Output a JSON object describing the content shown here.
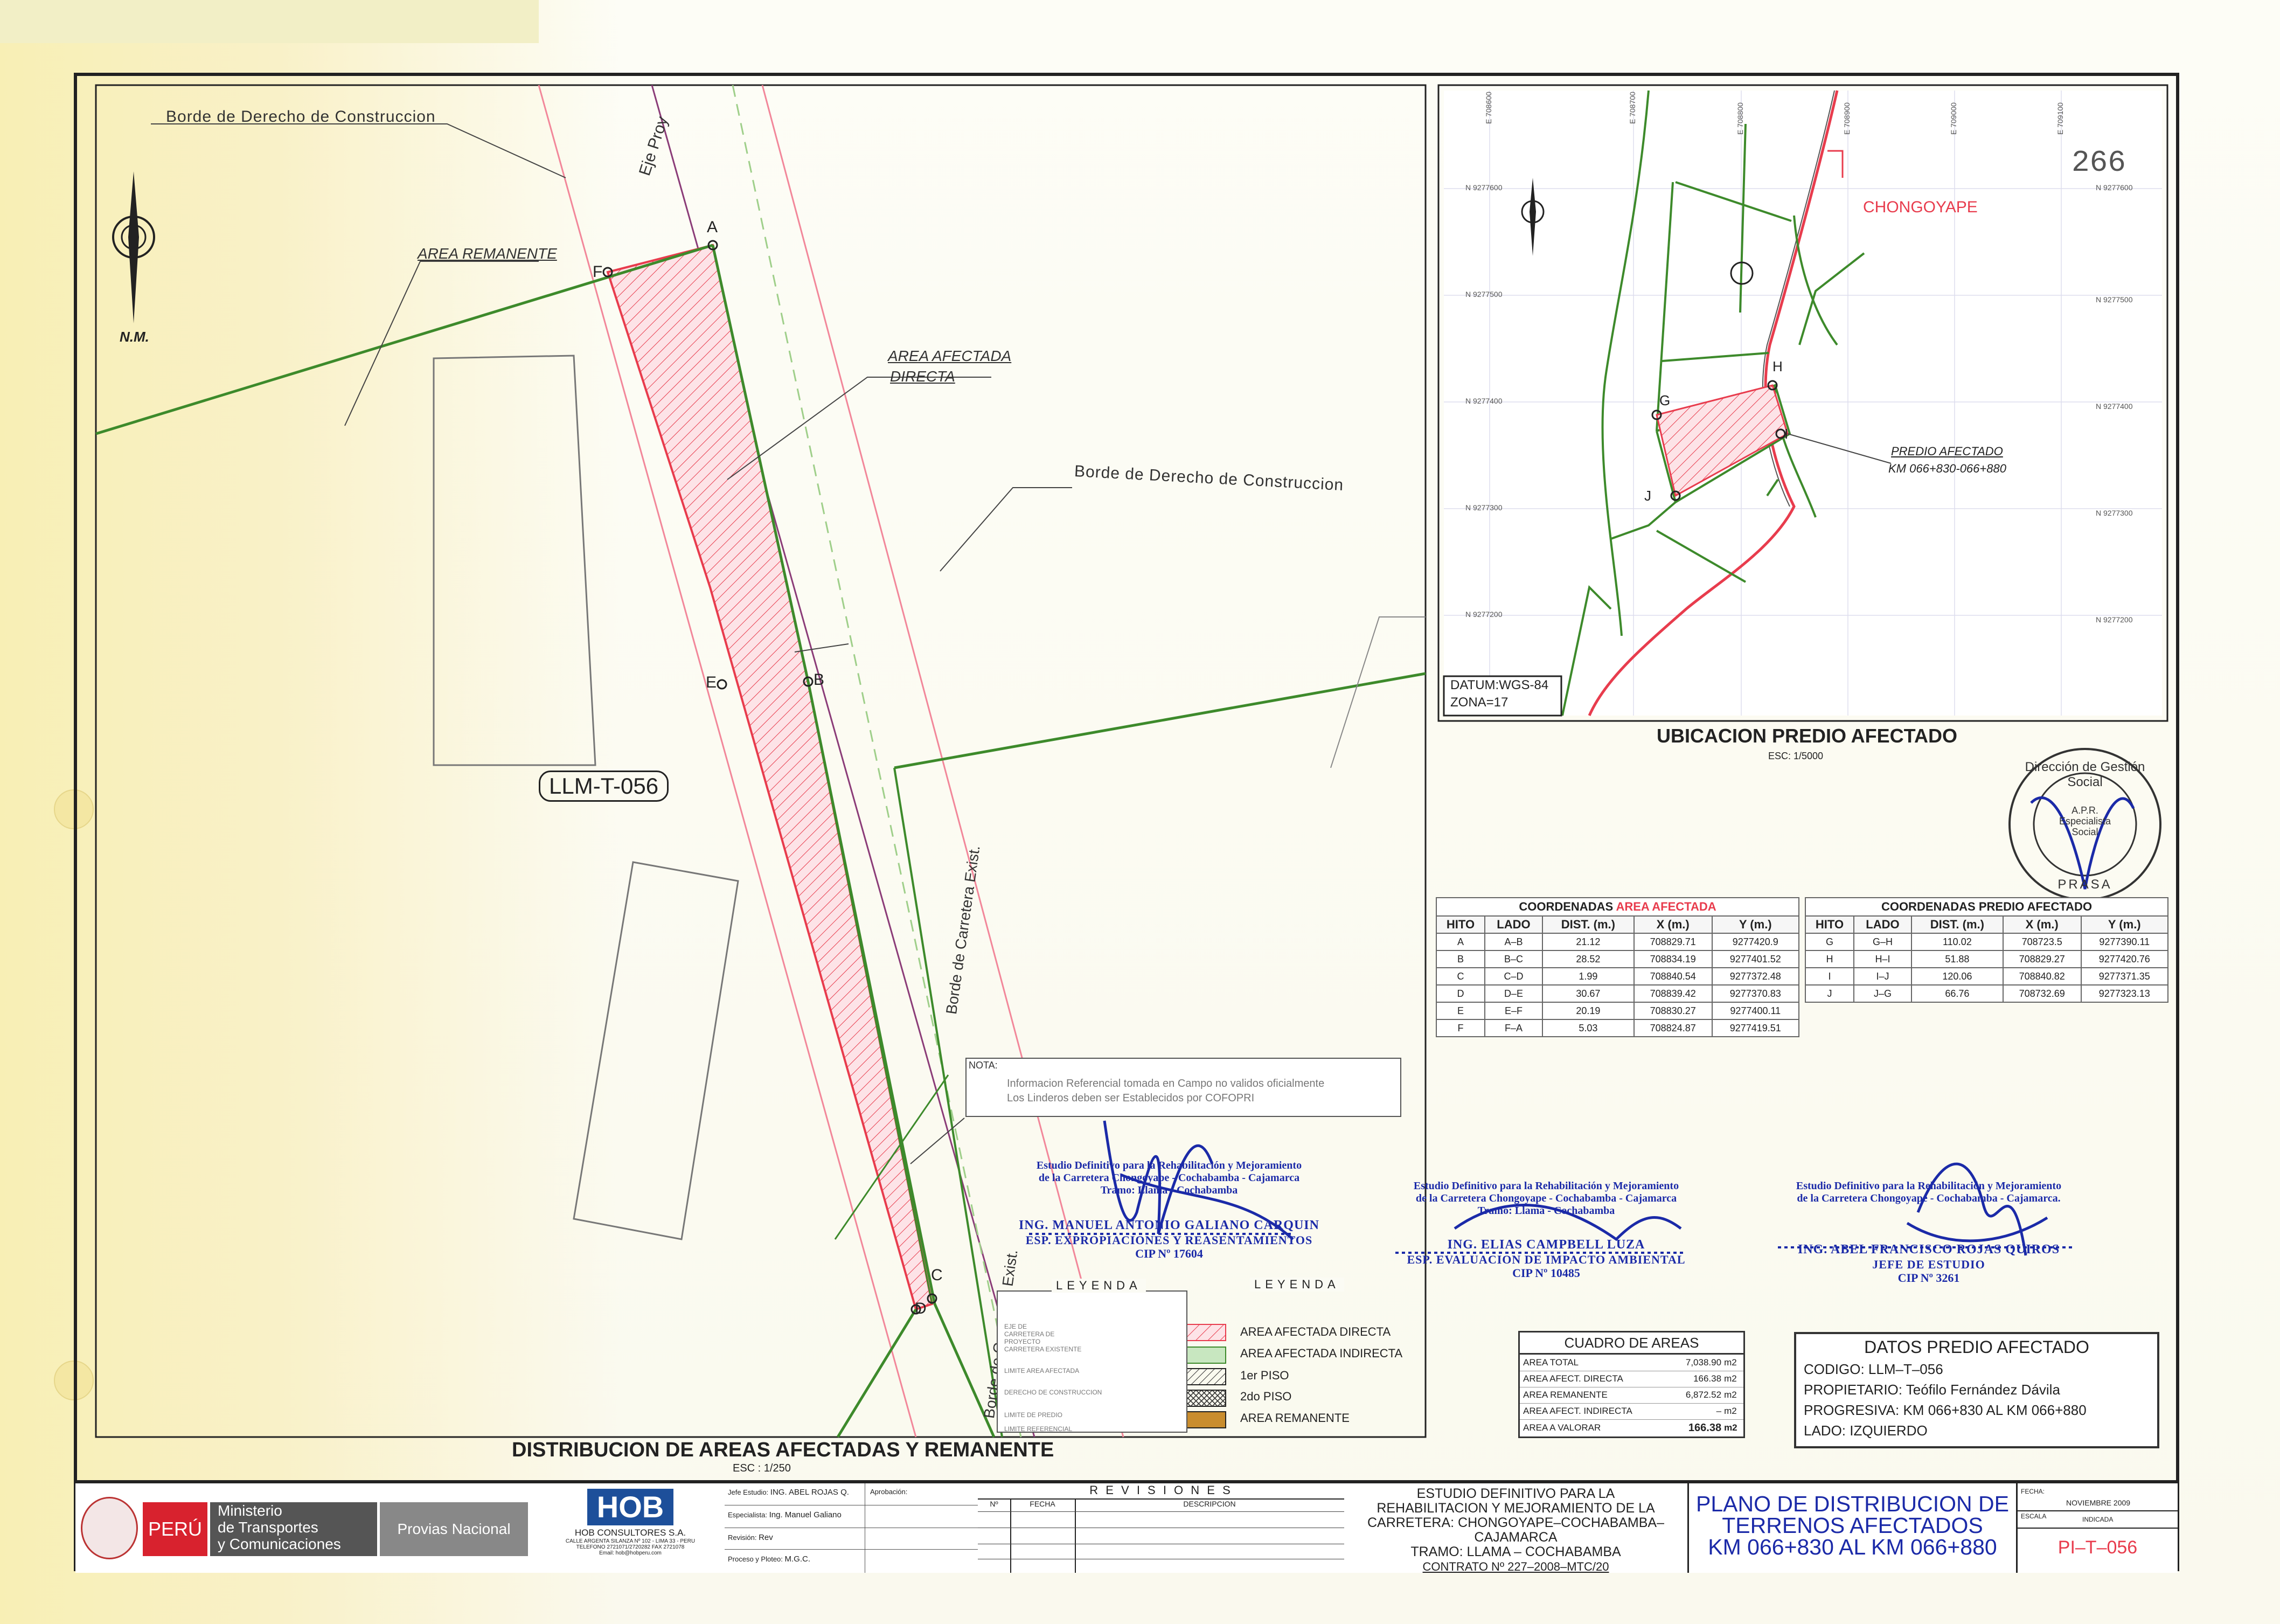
{
  "main_plan": {
    "labels": {
      "borde_top": "Borde de Derecho de Construccion",
      "borde_mid": "Borde de Derecho de Construccion",
      "area_remanente": "AREA REMANENTE",
      "area_afectada": "AREA AFECTADA",
      "directa": "DIRECTA",
      "eje_proy": "Eje Proy",
      "carretera_1": "Borde de Carretera Exist.",
      "carretera_2": "Borde de Carretera Exist.",
      "north": "N.M.",
      "parcel_id": "LLM-T-056"
    },
    "points": [
      "A",
      "B",
      "C",
      "D",
      "E",
      "F"
    ],
    "title": "DISTRIBUCION DE AREAS AFECTADAS Y REMANENTE",
    "scale": "ESC : 1/250",
    "nota": {
      "title": "NOTA:",
      "line1": "Informacion Referencial tomada en Campo no validos oficialmente",
      "line2": "Los Linderos deben ser Establecidos por COFOPRI"
    }
  },
  "location_map": {
    "sheet_number": "266",
    "place": "CHONGOYAPE",
    "predio_label_1": "PREDIO AFECTADO",
    "predio_label_2": "KM 066+830-066+880",
    "datum": "DATUM:WGS-84",
    "zona": "ZONA=17",
    "title": "UBICACION PREDIO AFECTADO",
    "scale": "ESC: 1/5000",
    "points": [
      "G",
      "H",
      "I",
      "J"
    ],
    "north_ticks": [
      "N 9277600",
      "N 9277500",
      "N 9277400",
      "N 9277300",
      "N 9277200"
    ],
    "east_ticks": [
      "E 708600",
      "E 708700",
      "E 708800",
      "E 708900",
      "E 709000",
      "E 709100"
    ]
  },
  "coord_area": {
    "caption_1": "COORDENADAS",
    "caption_2": "AREA AFECTADA",
    "headers": [
      "HITO",
      "LADO",
      "DIST. (m.)",
      "X (m.)",
      "Y (m.)"
    ],
    "rows": [
      [
        "A",
        "A–B",
        "21.12",
        "708829.71",
        "9277420.9"
      ],
      [
        "B",
        "B–C",
        "28.52",
        "708834.19",
        "9277401.52"
      ],
      [
        "C",
        "C–D",
        "1.99",
        "708840.54",
        "9277372.48"
      ],
      [
        "D",
        "D–E",
        "30.67",
        "708839.42",
        "9277370.83"
      ],
      [
        "E",
        "E–F",
        "20.19",
        "708830.27",
        "9277400.11"
      ],
      [
        "F",
        "F–A",
        "5.03",
        "708824.87",
        "9277419.51"
      ]
    ]
  },
  "coord_predio": {
    "caption": "COORDENADAS PREDIO AFECTADO",
    "headers": [
      "HITO",
      "LADO",
      "DIST. (m.)",
      "X (m.)",
      "Y (m.)"
    ],
    "rows": [
      [
        "G",
        "G–H",
        "110.02",
        "708723.5",
        "9277390.11"
      ],
      [
        "H",
        "H–I",
        "51.88",
        "708829.27",
        "9277420.76"
      ],
      [
        "I",
        "I–J",
        "120.06",
        "708840.82",
        "9277371.35"
      ],
      [
        "J",
        "J–G",
        "66.76",
        "708732.69",
        "9277323.13"
      ]
    ]
  },
  "legend_left": {
    "title": "LEYENDA",
    "items": [
      "EJE DE CARRETERA DE PROYECTO",
      "CARRETERA EXISTENTE",
      "LIMITE AREA AFECTADA",
      "DERECHO DE CONSTRUCCION",
      "LIMITE DE PREDIO",
      "LIMITE REFERENCIAL"
    ]
  },
  "legend_right": {
    "title": "LEYENDA",
    "items": [
      "AREA AFECTADA DIRECTA",
      "AREA AFECTADA INDIRECTA",
      "1er PISO",
      "2do PISO",
      "AREA REMANENTE"
    ]
  },
  "signatures": {
    "s1": {
      "line1": "Estudio Definitivo para la Rehabilitación y Mejoramiento",
      "line2": "de la Carretera Chongoyape - Cochabamba - Cajamarca",
      "line3": "Tramo: Llama - Cochabamba",
      "name": "ING. MANUEL ANTONIO GALIANO CARQUIN",
      "role": "ESP. EXPROPIACIONES Y REASENTAMIENTOS",
      "cip": "CIP Nº 17604"
    },
    "s2": {
      "line1": "Estudio Definitivo para la Rehabilitación y Mejoramiento",
      "line2": "de la Carretera Chongoyape - Cochabamba - Cajamarca",
      "line3": "Tramo: Llama - Cochabamba",
      "name": "ING. ELIAS CAMPBELL LUZA",
      "role": "ESP. EVALUACION DE IMPACTO AMBIENTAL",
      "cip": "CIP Nº 10485"
    },
    "s3": {
      "line1": "Estudio Definitivo para la Rehabilitación y Mejoramiento",
      "line2": "de la Carretera Chongoyape - Cochabamba - Cajamarca.",
      "name": "ING. ABEL FRANCISCO ROJAS QUIROS",
      "role": "JEFE DE ESTUDIO",
      "cip": "CIP Nº 3261"
    }
  },
  "seal": {
    "top": "Dirección de Gestión Social",
    "center1": "A.P.R.",
    "center2": "Especialista",
    "center3": "Social",
    "bottom": "PRASA"
  },
  "cuadro_areas": {
    "title": "CUADRO DE AREAS",
    "rows": [
      [
        "AREA TOTAL",
        "7,038.90",
        "m2"
      ],
      [
        "AREA AFECT. DIRECTA",
        "166.38",
        "m2"
      ],
      [
        "AREA REMANENTE",
        "6,872.52",
        "m2"
      ],
      [
        "AREA AFECT. INDIRECTA",
        "–",
        "m2"
      ],
      [
        "AREA A VALORAR",
        "166.38",
        "m2"
      ]
    ]
  },
  "datos_predio": {
    "title": "DATOS PREDIO AFECTADO",
    "codigo_label": "CODIGO:",
    "codigo": "LLM–T–056",
    "propietario_label": "PROPIETARIO:",
    "propietario": "Teófilo Fernández Dávila",
    "progresiva_label": "PROGRESIVA:",
    "progresiva": "KM 066+830 AL KM 066+880",
    "lado_label": "LADO:",
    "lado": "IZQUIERDO"
  },
  "title_block": {
    "peru": "PERÚ",
    "ministerio_1": "Ministerio",
    "ministerio_2": "de Transportes",
    "ministerio_3": "y Comunicaciones",
    "provias": "Provias Nacional",
    "hob_logo": "HOB",
    "hob_name": "HOB CONSULTORES S.A.",
    "hob_addr1": "CALLE ARGENTA SILANZA Nº 102 - LIMA 33 - PERU",
    "hob_addr2": "TELEFONO 2721071/2720282 FAX 2721078",
    "hob_addr3": "Email: hob@hobperu.com",
    "jefe_label": "Jefe Estudio:",
    "jefe": "ING. ABEL ROJAS Q.",
    "aprob_label": "Aprobación:",
    "espec_label": "Especialista:",
    "espec": "Ing. Manuel Galiano",
    "revis_label": "Revisión:",
    "revis": "Rev",
    "proceso_label": "Proceso y Ploteo:",
    "proceso": "M.G.C.",
    "revisiones": "R E V I S I O N E S",
    "rev_n": "Nº",
    "rev_fecha": "FECHA",
    "rev_desc": "DESCRIPCION",
    "project_1": "ESTUDIO DEFINITIVO PARA LA",
    "project_2": "REHABILITACION Y MEJORAMIENTO DE LA",
    "project_3": "CARRETERA: CHONGOYAPE–COCHABAMBA–CAJAMARCA",
    "project_4": "TRAMO: LLAMA – COCHABAMBA",
    "contrato": "CONTRATO Nº 227–2008–MTC/20",
    "plan_1": "PLANO DE DISTRIBUCION DE",
    "plan_2": "TERRENOS AFECTADOS",
    "plan_3": "KM 066+830 AL KM 066+880",
    "fecha_label": "FECHA:",
    "fecha": "NOVIEMBRE 2009",
    "escala_label": "ESCALA",
    "escala": "INDICADA",
    "sheet": "PI–T–056"
  },
  "colors": {
    "red": "#e83c4d",
    "green": "#3d8a2b",
    "blue": "#1b2aa8",
    "frame": "#222222"
  }
}
